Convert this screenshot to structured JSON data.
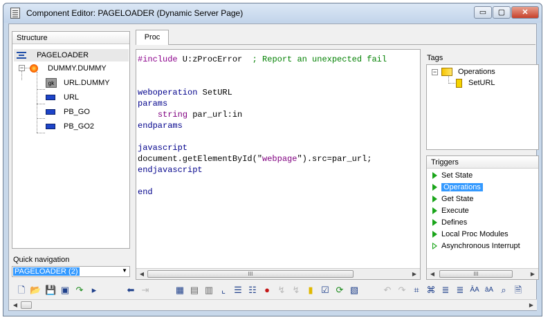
{
  "window": {
    "title": "Component Editor: PAGELOADER (Dynamic Server Page)",
    "buttons": {
      "minimize": "▭",
      "maximize": "▢",
      "close": "✕"
    }
  },
  "structure": {
    "header": "Structure",
    "root": "PAGELOADER",
    "entity": "DUMMY.DUMMY",
    "fields": [
      {
        "label": "URL.DUMMY",
        "icon": "gk-field-icon",
        "icon_text": "gk"
      },
      {
        "label": "URL",
        "icon": "field-icon"
      },
      {
        "label": "PB_GO",
        "icon": "field-icon"
      },
      {
        "label": "PB_GO2",
        "icon": "field-icon"
      }
    ]
  },
  "quick_navigation": {
    "label": "Quick navigation",
    "value": "PAGELOADER (2)"
  },
  "editor": {
    "tab": "Proc",
    "code_lines": [
      "#include U:zProcError  ; Report an unexpected fail",
      "",
      "",
      "weboperation SetURL",
      "params",
      "    string par_url:in",
      "endparams",
      "",
      "javascript",
      "document.getElementById(\"webpage\").src=par_url;",
      "endjavascript",
      "",
      "end"
    ],
    "scroll_grip": "III"
  },
  "tags": {
    "label": "Tags",
    "node": "Operations",
    "child": "SetURL"
  },
  "triggers": {
    "header": "Triggers",
    "items": [
      "Set State",
      "Operations",
      "Get State",
      "Execute",
      "Defines",
      "Local Proc Modules",
      "Asynchronous Interrupt"
    ],
    "selected_index": 1,
    "scroll_grip": "III"
  },
  "colors": {
    "preprocessor": "#8b008b",
    "comment": "#008000",
    "keyword": "#00008b",
    "type": "#800080",
    "string": "#800080",
    "selection": "#3399ff"
  }
}
